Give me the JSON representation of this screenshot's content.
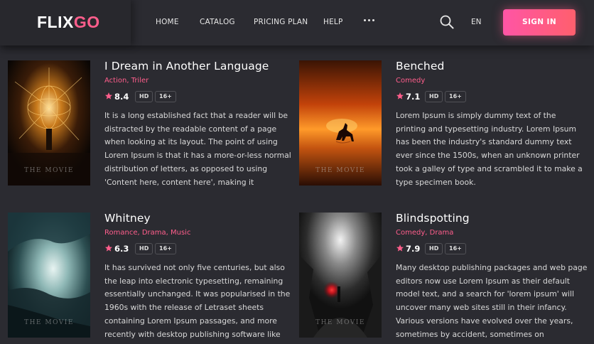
{
  "header": {
    "logo": {
      "main": "FLIX",
      "accent": "GO"
    },
    "nav": [
      "HOME",
      "CATALOG",
      "PRICING PLAN",
      "HELP"
    ],
    "more_icon": "ellipsis-icon",
    "search_icon": "search-icon",
    "language": "EN",
    "signin_label": "SIGN IN"
  },
  "colors": {
    "accent": "#ff5e8c",
    "background": "#2b2b31"
  },
  "movies": [
    {
      "title": "I Dream in Another Language",
      "genres": "Action, Triler",
      "rating": "8.4",
      "badges": [
        "HD",
        "16+"
      ],
      "poster_caption": "THE MOVIE",
      "description": "It is a long established fact that a reader will be distracted by the readable content of a page when looking at its layout. The point of using Lorem Ipsum is that it has a more-or-less normal distribution of letters, as opposed to using 'Content here, content here', making it"
    },
    {
      "title": "Benched",
      "genres": "Comedy",
      "rating": "7.1",
      "badges": [
        "HD",
        "16+"
      ],
      "poster_caption": "THE MOVIE",
      "description": "Lorem Ipsum is simply dummy text of the printing and typesetting industry. Lorem Ipsum has been the industry's standard dummy text ever since the 1500s, when an unknown printer took a galley of type and scrambled it to make a type specimen book."
    },
    {
      "title": "Whitney",
      "genres": "Romance, Drama, Music",
      "rating": "6.3",
      "badges": [
        "HD",
        "16+"
      ],
      "poster_caption": "THE MOVIE",
      "description": "It has survived not only five centuries, but also the leap into electronic typesetting, remaining essentially unchanged. It was popularised in the 1960s with the release of Letraset sheets containing Lorem Ipsum passages, and more recently with desktop publishing software like"
    },
    {
      "title": "Blindspotting",
      "genres": "Comedy, Drama",
      "rating": "7.9",
      "badges": [
        "HD",
        "16+"
      ],
      "poster_caption": "THE MOVIE",
      "description": "Many desktop publishing packages and web page editors now use Lorem Ipsum as their default model text, and a search for 'lorem ipsum' will uncover many web sites still in their infancy. Various versions have evolved over the years, sometimes by accident, sometimes on"
    }
  ]
}
